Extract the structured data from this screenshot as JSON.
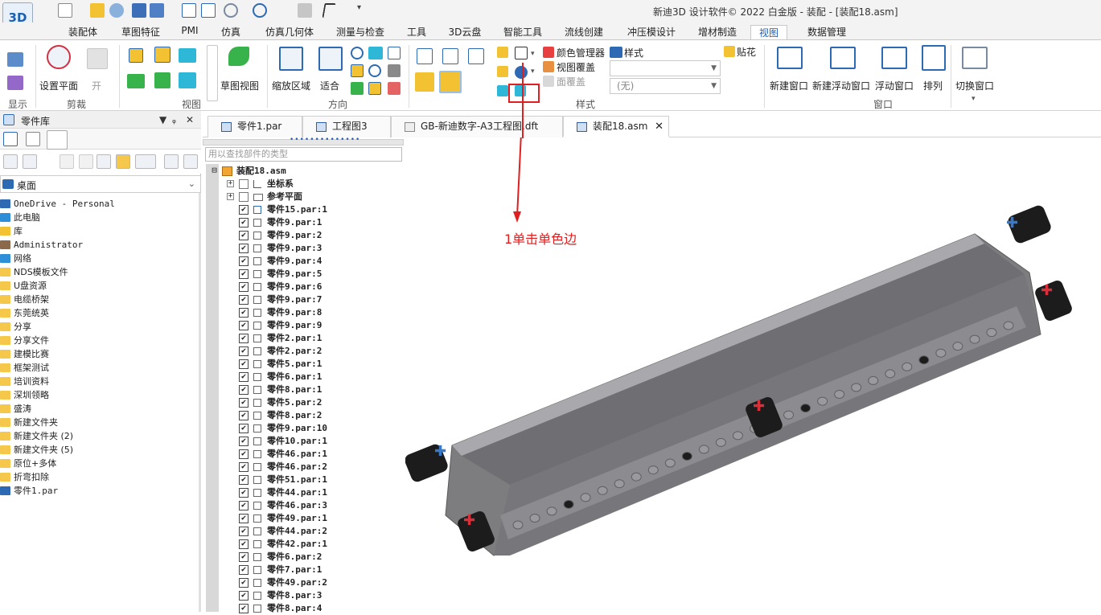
{
  "window": {
    "title": "新迪3D 设计软件© 2022 白金版 - 装配 - [装配18.asm]",
    "logo": "3D"
  },
  "ribbon_tabs": [
    {
      "label": "装配体"
    },
    {
      "label": "草图特征"
    },
    {
      "label": "PMI"
    },
    {
      "label": "仿真"
    },
    {
      "label": "仿真几何体"
    },
    {
      "label": "测量与检查"
    },
    {
      "label": "工具"
    },
    {
      "label": "3D云盘"
    },
    {
      "label": "智能工具"
    },
    {
      "label": "流线创建"
    },
    {
      "label": "冲压模设计"
    },
    {
      "label": "增材制造"
    },
    {
      "label": "视图",
      "active": true
    },
    {
      "label": "数据管理"
    }
  ],
  "ribbon": {
    "groups": {
      "show": "显示",
      "clip": "剪裁",
      "views": "视图",
      "orient": "方向",
      "style": "样式",
      "window": "窗口"
    },
    "buttons": {
      "set_plane": "设置平面",
      "open": "开",
      "sketch_view": "草图视图",
      "zoom_area": "缩放区域",
      "fit": "适合",
      "color_manager": "颜色管理器",
      "view_overlay": "视图覆盖",
      "face_overlay": "面覆盖",
      "decal": "贴花",
      "style_label": "样式",
      "style_value": "(无)",
      "new_window": "新建窗口",
      "new_float_window": "新建浮动窗口",
      "float_window": "浮动窗口",
      "arrange": "排列",
      "switch_window": "切换窗口"
    }
  },
  "parts_library": {
    "title": "零件库",
    "location": "桌面",
    "items": [
      {
        "label": "OneDrive - Personal",
        "icon": "cloud-icon"
      },
      {
        "label": "此电脑",
        "icon": "computer-icon"
      },
      {
        "label": "库",
        "icon": "library-icon"
      },
      {
        "label": "Administrator",
        "icon": "user-icon"
      },
      {
        "label": "网络",
        "icon": "network-icon"
      },
      {
        "label": "NDS模板文件",
        "icon": "folder-icon"
      },
      {
        "label": "U盘资源",
        "icon": "folder-icon"
      },
      {
        "label": "电缆桥架",
        "icon": "folder-icon"
      },
      {
        "label": "东莞统英",
        "icon": "folder-icon"
      },
      {
        "label": "分享",
        "icon": "folder-icon"
      },
      {
        "label": "分享文件",
        "icon": "folder-icon"
      },
      {
        "label": "建模比赛",
        "icon": "folder-icon"
      },
      {
        "label": "框架测试",
        "icon": "folder-icon"
      },
      {
        "label": "培训资料",
        "icon": "folder-icon"
      },
      {
        "label": "深圳领略",
        "icon": "folder-icon"
      },
      {
        "label": "盛涛",
        "icon": "folder-icon"
      },
      {
        "label": "新建文件夹",
        "icon": "folder-icon"
      },
      {
        "label": "新建文件夹 (2)",
        "icon": "folder-icon"
      },
      {
        "label": "新建文件夹 (5)",
        "icon": "folder-icon"
      },
      {
        "label": "原位+多体",
        "icon": "folder-icon"
      },
      {
        "label": "折弯扣除",
        "icon": "folder-icon"
      },
      {
        "label": "零件1.par",
        "icon": "part-file-icon"
      }
    ]
  },
  "doc_tabs": [
    {
      "label": "零件1.par"
    },
    {
      "label": "工程图3"
    },
    {
      "label": "GB-新迪数字-A3工程图.dft"
    },
    {
      "label": "装配18.asm",
      "active": true,
      "close": "✕"
    }
  ],
  "pathfinder": {
    "search_placeholder": "用以查找部件的类型",
    "root": "装配18.asm",
    "nodes": [
      {
        "label": "坐标系",
        "expand": "+"
      },
      {
        "label": "参考平面",
        "expand": "+"
      }
    ],
    "parts": [
      "零件15.par:1",
      "零件9.par:1",
      "零件9.par:2",
      "零件9.par:3",
      "零件9.par:4",
      "零件9.par:5",
      "零件9.par:6",
      "零件9.par:7",
      "零件9.par:8",
      "零件9.par:9",
      "零件2.par:1",
      "零件2.par:2",
      "零件5.par:1",
      "零件6.par:1",
      "零件8.par:1",
      "零件5.par:2",
      "零件8.par:2",
      "零件9.par:10",
      "零件10.par:1",
      "零件46.par:1",
      "零件46.par:2",
      "零件51.par:1",
      "零件44.par:1",
      "零件46.par:3",
      "零件49.par:1",
      "零件44.par:2",
      "零件42.par:1",
      "零件6.par:2",
      "零件7.par:1",
      "零件49.par:2",
      "零件8.par:3",
      "零件8.par:4"
    ],
    "check": "✔"
  },
  "annotation": {
    "text": "1单击单色边",
    "color": "#e02020"
  },
  "colors": {
    "accent": "#1f5fb5",
    "model_gray": "#7d7d80",
    "model_dark": "#1c1c1c",
    "axis_red": "#d8303a",
    "axis_blue": "#3a78c8"
  }
}
